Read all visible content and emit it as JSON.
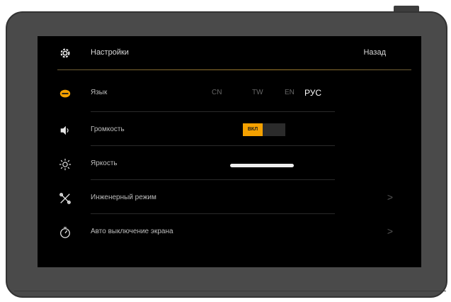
{
  "header": {
    "title": "Настройки",
    "back_label": "Назад"
  },
  "rows": [
    {
      "label": "Язык",
      "icon": "language-icon"
    },
    {
      "label": "Громкость",
      "icon": "speaker-icon",
      "toggle_label": "ВКЛ"
    },
    {
      "label": "Яркость",
      "icon": "brightness-icon",
      "level": 1.0
    },
    {
      "label": "Инженерный режим",
      "icon": "engineering-icon"
    },
    {
      "label": "Авто выключение экрана",
      "icon": "timer-icon"
    }
  ],
  "languages": [
    "CN",
    "TW",
    "EN",
    "РУС"
  ],
  "selected_language": "РУС",
  "colors": {
    "accent": "#f5a100",
    "screen_bg": "#000000",
    "bezel": "#4a4a4a"
  }
}
